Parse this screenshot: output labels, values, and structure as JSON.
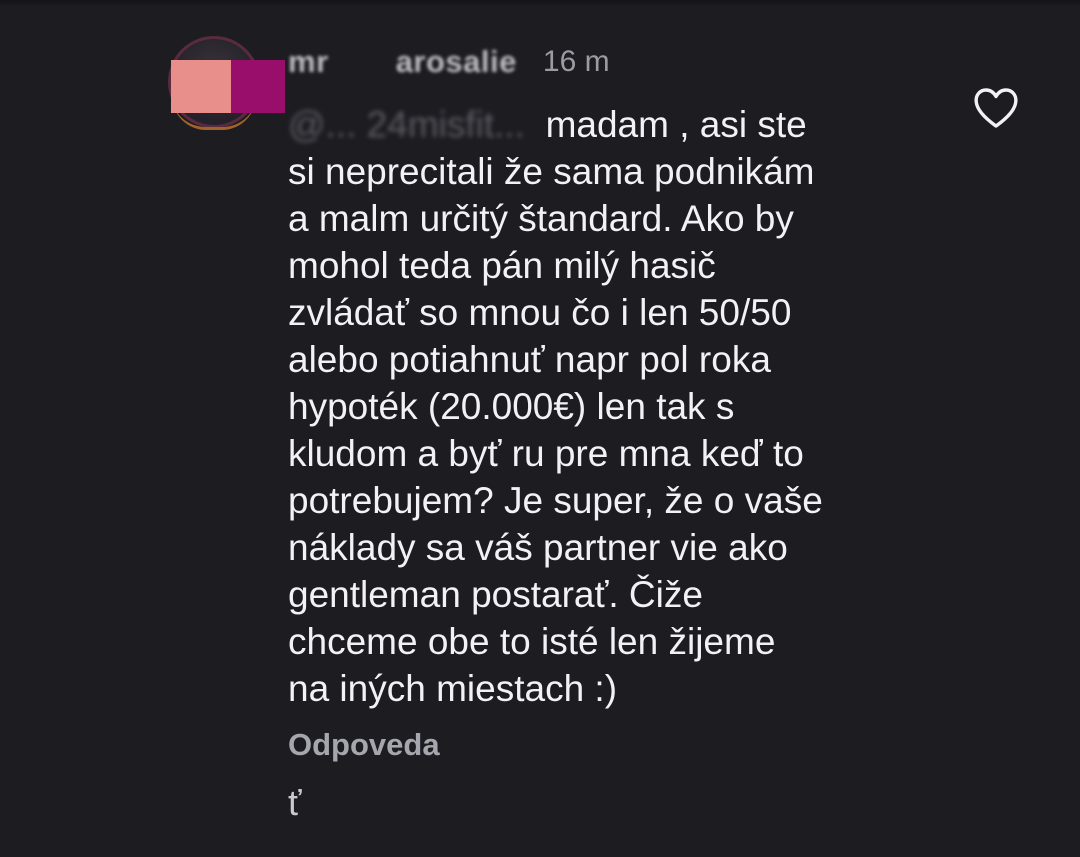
{
  "comment": {
    "username": "mr          arosalie",
    "time": "16 m",
    "mention": "@... 24misfit...",
    "lines": [
      "madam , asi ste",
      "si neprecitali že sama podnikám",
      "a malm určitý štandard. Ako by",
      "mohol teda pán milý hasič",
      "zvládať so mnou čo i len 50/50",
      "alebo potiahnuť napr pol roka",
      "hypoték (20.000€) len tak s",
      "kludom a byť ru pre mna keď to",
      "potrebujem? Je super, že o vaše",
      "náklady sa váš partner vie ako",
      "gentleman postarať. Čiže",
      "chceme obe to isté len žijeme",
      "na iných miestach :)"
    ],
    "reply_label": "Odpoveda",
    "stray_text": "ť"
  },
  "icons": {
    "like": "heart-outline-icon",
    "avatar": "profile-avatar"
  },
  "colors": {
    "background": "#1c1c21",
    "text": "#f2f2f4",
    "muted": "#a6a6ae",
    "redact_left": "#e88f8c",
    "redact_right": "#990e6b"
  }
}
